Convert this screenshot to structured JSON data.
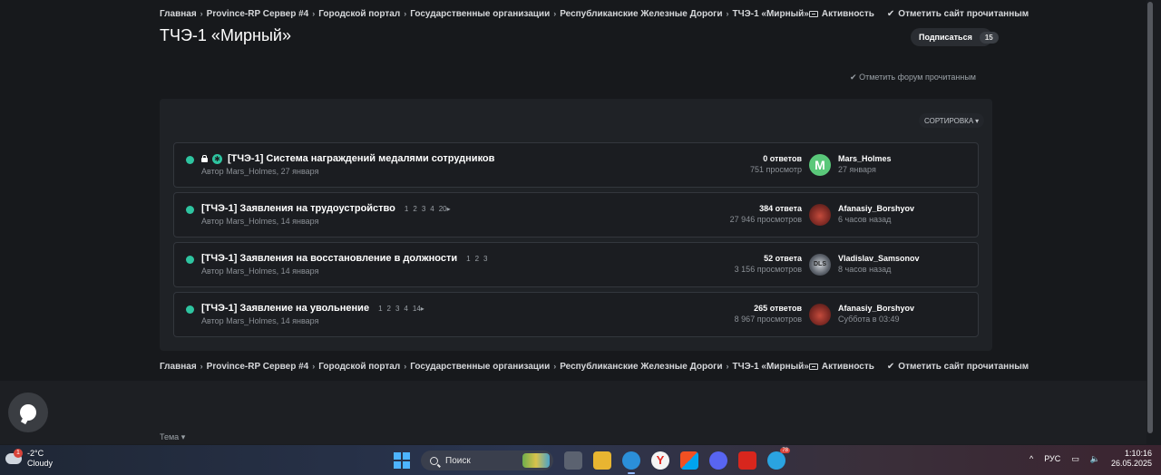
{
  "breadcrumb": [
    "Главная",
    "Province-RP Сервер #4",
    "Городской портал",
    "Государственные организации",
    "Республиканские Железные Дороги",
    "ТЧЭ-1 «Мирный»"
  ],
  "actions": {
    "activity": "Активность",
    "mark_site_read": "Отметить сайт прочитанным"
  },
  "page_title": "ТЧЭ-1 «Мирный»",
  "subscribe": {
    "label": "Подписаться",
    "count": "15"
  },
  "mark_forum_read": "Отметить форум прочитанным",
  "sort_label": "СОРТИРОВКА",
  "threads": [
    {
      "title": "[ТЧЭ-1] Система награждений медалями сотрудников",
      "author": "Автор Mars_Holmes, 27 января",
      "pages": [],
      "replies": "0 ответов",
      "views": "751 просмотр",
      "last_user": "Mars_Holmes",
      "last_time": "27 января",
      "avatar_letter": "M",
      "locked": true,
      "pinned": true
    },
    {
      "title": "[ТЧЭ-1] Заявления на трудоустройство",
      "author": "Автор Mars_Holmes, 14 января",
      "pages": [
        "1",
        "2",
        "3",
        "4",
        "20"
      ],
      "replies": "384 ответа",
      "views": "27 946 просмотров",
      "last_user": "Afanasiy_Borshyov",
      "last_time": "6 часов назад",
      "avatar_letter": ""
    },
    {
      "title": "[ТЧЭ-1] Заявления на восстановление в должности",
      "author": "Автор Mars_Holmes, 14 января",
      "pages": [
        "1",
        "2",
        "3"
      ],
      "replies": "52 ответа",
      "views": "3 156 просмотров",
      "last_user": "Vladislav_Samsonov",
      "last_time": "8 часов назад",
      "avatar_letter": "DLS"
    },
    {
      "title": "[ТЧЭ-1] Заявление на увольнение",
      "author": "Автор Mars_Holmes, 14 января",
      "pages": [
        "1",
        "2",
        "3",
        "4",
        "14"
      ],
      "replies": "265 ответов",
      "views": "8 967 просмотров",
      "last_user": "Afanasiy_Borshyov",
      "last_time": "Суббота в 03:49",
      "avatar_letter": ""
    }
  ],
  "theme_label": "Тема",
  "taskbar": {
    "weather_temp": "-2°C",
    "weather_desc": "Cloudy",
    "weather_badge": "1",
    "search_placeholder": "Поиск",
    "telegram_badge": "78",
    "lang": "РУС",
    "time": "1:10:16",
    "date": "26.05.2025"
  }
}
